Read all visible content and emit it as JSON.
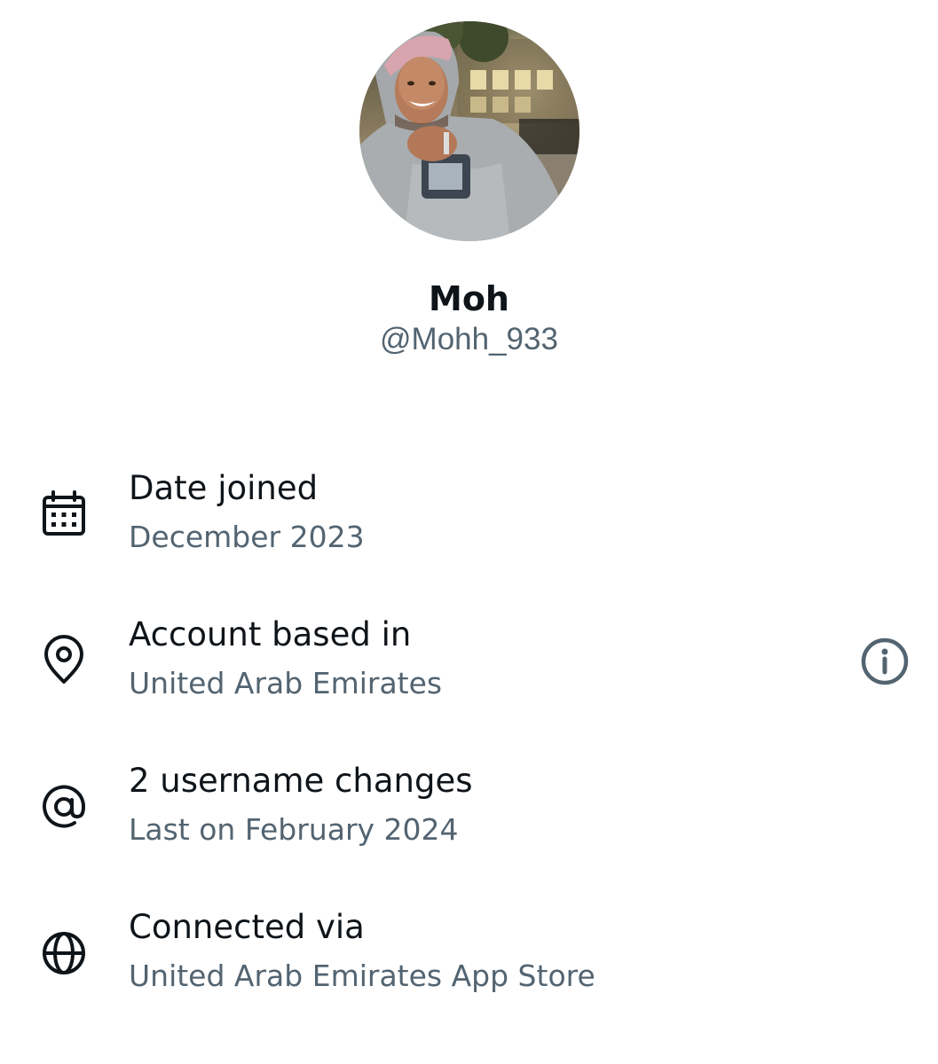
{
  "colors": {
    "primary_text": "#0f1419",
    "secondary_text": "#536471",
    "background": "#ffffff"
  },
  "profile": {
    "display_name": "Moh",
    "handle": "@Mohh_933",
    "avatar_icon": "profile-photo"
  },
  "rows": [
    {
      "icon": "calendar-icon",
      "label": "Date joined",
      "value": "December 2023"
    },
    {
      "icon": "location-pin-icon",
      "label": "Account based in",
      "value": "United Arab Emirates",
      "action_icon": "info-icon"
    },
    {
      "icon": "at-sign-icon",
      "label": "2 username changes",
      "value": "Last on February 2024"
    },
    {
      "icon": "globe-icon",
      "label": "Connected via",
      "value": "United Arab Emirates App Store"
    }
  ]
}
